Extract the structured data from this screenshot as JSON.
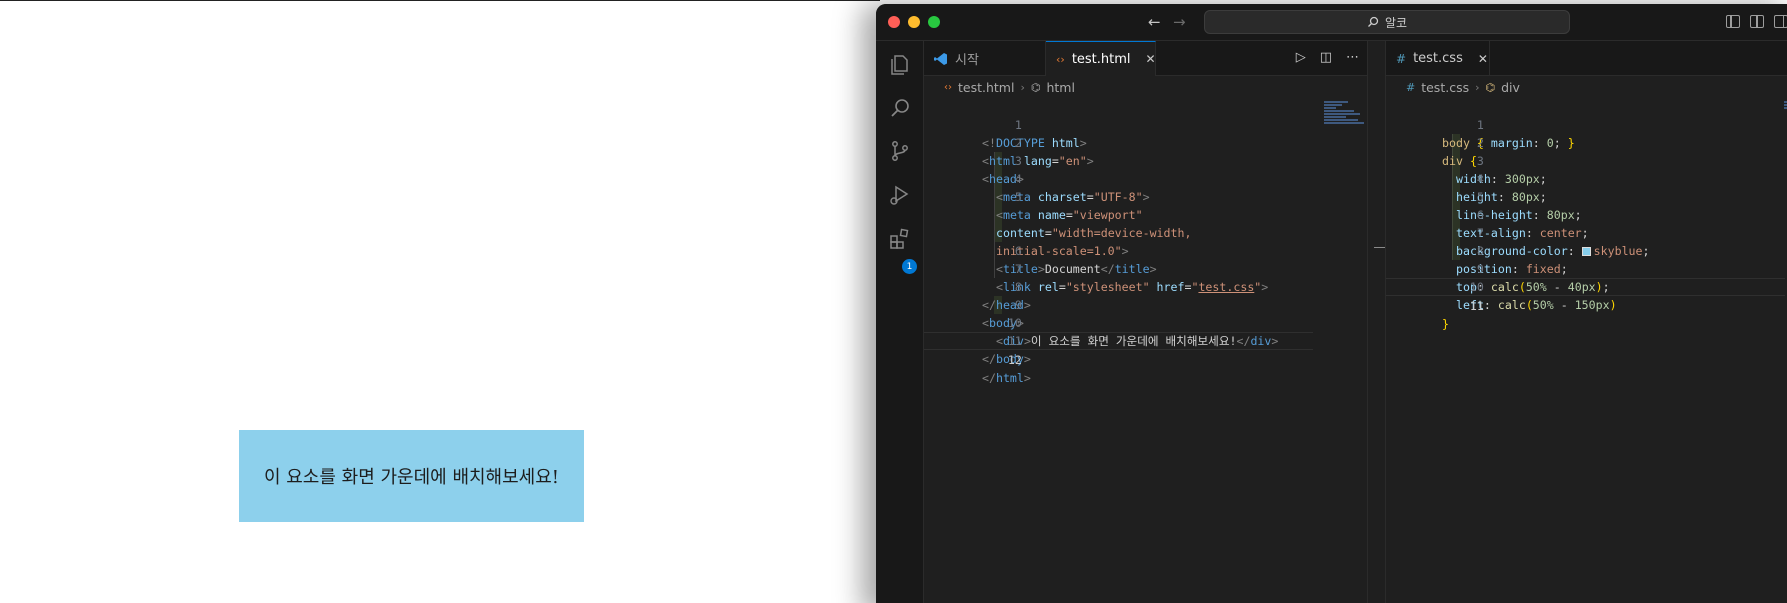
{
  "preview": {
    "box_text": "이 요소를 화면 가운데에 배치해보세요!"
  },
  "titlebar": {
    "search_text": "알코"
  },
  "activity": {
    "extensions_badge": "1"
  },
  "left_editor": {
    "tabs": [
      {
        "label": "시작",
        "active": false
      },
      {
        "label": "test.html",
        "active": true,
        "close": "✕"
      }
    ],
    "breadcrumb": [
      "test.html",
      "html"
    ],
    "lines": [
      {
        "n": "1"
      },
      {
        "n": "2"
      },
      {
        "n": "3"
      },
      {
        "n": "4"
      },
      {
        "n": "5"
      },
      {
        "n": ""
      },
      {
        "n": ""
      },
      {
        "n": "6"
      },
      {
        "n": "7"
      },
      {
        "n": "8"
      },
      {
        "n": "9"
      },
      {
        "n": "10"
      },
      {
        "n": "11"
      },
      {
        "n": "12"
      }
    ]
  },
  "right_editor": {
    "tabs": [
      {
        "label": "test.css",
        "active": false,
        "close": "✕"
      }
    ],
    "breadcrumb": [
      "test.css",
      "div"
    ],
    "lines": [
      {
        "n": "1"
      },
      {
        "n": "2"
      },
      {
        "n": "3"
      },
      {
        "n": "4"
      },
      {
        "n": "5"
      },
      {
        "n": "6"
      },
      {
        "n": "7"
      },
      {
        "n": "8"
      },
      {
        "n": "9"
      },
      {
        "n": "10"
      },
      {
        "n": "11"
      }
    ]
  },
  "code": {
    "html": {
      "doctype_open": "<!",
      "doctype_kw": "DOCTYPE",
      "doctype_html": " html",
      "gt": ">",
      "lt": "<",
      "lt_close": "</",
      "html_tag": "html",
      "lang_attr": " lang",
      "eq": "=",
      "lang_val": "\"en\"",
      "head_tag": "head",
      "meta_tag": "meta",
      "charset_attr": " charset",
      "charset_val": "\"UTF-8\"",
      "name_attr": " name",
      "name_val": "\"viewport\"",
      "content_attr": "content",
      "content_val1": "\"width=device-width,",
      "content_val2": "initial-scale=1.0\"",
      "title_tag": "title",
      "title_text": "Document",
      "link_tag": "link",
      "rel_attr": " rel",
      "rel_val": "\"stylesheet\"",
      "href_attr": " href",
      "q": "\"",
      "href_val": "test.css",
      "body_tag": "body",
      "div_tag": "div",
      "div_text": "이 요소를 화면 가운데에 배치해보세요!"
    },
    "css": {
      "body_sel": "body",
      "margin_prop": "margin",
      "margin_val": "0",
      "div_sel": "div",
      "open_brace": "{",
      "close_brace": "}",
      "colon": ":",
      "semi": ";",
      "width_prop": "width",
      "width_val": "300px",
      "height_prop": "height",
      "height_val": "80px",
      "lh_prop": "line-height",
      "lh_val": "80px",
      "ta_prop": "text-align",
      "ta_val": "center",
      "bg_prop": "background-color",
      "bg_val": "skyblue",
      "pos_prop": "position",
      "pos_val": "fixed",
      "top_prop": "top",
      "top_fn": "calc",
      "top_arg1": "50%",
      "minus": " - ",
      "top_arg2": "40px",
      "left_prop": "left",
      "left_fn": "calc",
      "left_arg1": "50%",
      "left_arg2": "150px",
      "lparen": "(",
      "rparen": ")"
    }
  },
  "colors": {
    "box_bg": "#87ceeb",
    "accent": "#0078d4",
    "editor_bg": "#1f1f1f"
  }
}
